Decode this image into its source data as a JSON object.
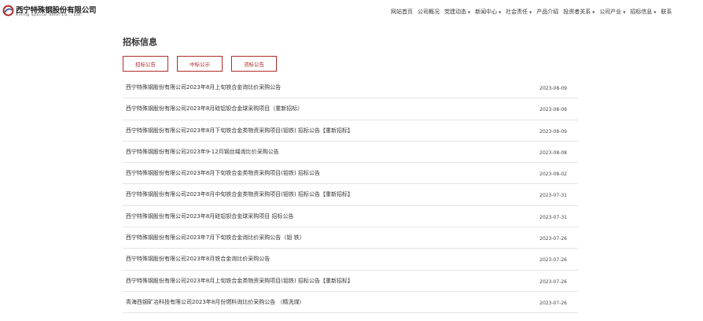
{
  "brand": {
    "name_cn": "西宁特殊钢股份有限公司",
    "name_en": "Xining Special Steel Co. , Ltd.",
    "accent": "#b22a2a"
  },
  "nav": [
    {
      "label": "网站首页",
      "dropdown": false
    },
    {
      "label": "公司概况",
      "dropdown": false
    },
    {
      "label": "党建动态",
      "dropdown": true
    },
    {
      "label": "新闻中心",
      "dropdown": true
    },
    {
      "label": "社会责任",
      "dropdown": true
    },
    {
      "label": "产品介绍",
      "dropdown": false
    },
    {
      "label": "投资者关系",
      "dropdown": true
    },
    {
      "label": "公司产业",
      "dropdown": true
    },
    {
      "label": "招标信息",
      "dropdown": true
    },
    {
      "label": "联系",
      "dropdown": false
    }
  ],
  "page_title": "招标信息",
  "tabs": [
    "招标公告",
    "中标公示",
    "流标公告"
  ],
  "items": [
    {
      "title": "西宁特殊钢股份有限公司2023年8月上旬铁合金询比价采购公告",
      "date": "2023-08-09"
    },
    {
      "title": "西宁特殊钢股份有限公司2023年8月硅铝钡合金球采购项目（重新招标）",
      "date": "2023-08-09"
    },
    {
      "title": "西宁特殊钢股份有限公司2023年8月下旬铁合金类物资采购项目(钼铁) 招标公告【重新招标】",
      "date": "2023-08-09"
    },
    {
      "title": "西宁特殊钢股份有限公司2023年9-12月钢丝绳询比价采购公告",
      "date": "2023-08-08"
    },
    {
      "title": "西宁特殊钢股份有限公司2023年8月下旬铁合金类物资采购项目(钼铁) 招标公告",
      "date": "2023-08-02"
    },
    {
      "title": "西宁特殊钢股份有限公司2023年8月中旬铁合金类物资采购项目(钼铁) 招标公告【重新招标】",
      "date": "2023-07-31"
    },
    {
      "title": "西宁特殊钢股份有限公司2023年8月硅铝钡合金球采购项目 招标公告",
      "date": "2023-07-31"
    },
    {
      "title": "西宁特殊钢股份有限公司2023年7月下旬铁合金询比价采购公告（钼 铁）",
      "date": "2023-07-26"
    },
    {
      "title": "西宁特殊钢股份有限公司2023年8月铁合金询比价采购公告",
      "date": "2023-07-26"
    },
    {
      "title": "西宁特殊钢股份有限公司2023年8月上旬铁合金类物资采购项目(钼铁) 招标公告【重新招标】",
      "date": "2023-07-26"
    },
    {
      "title": "青海西钢矿冶科技有限公司2023年8月份燃料询比价采购公告 （精洗煤）",
      "date": "2023-07-26"
    }
  ]
}
